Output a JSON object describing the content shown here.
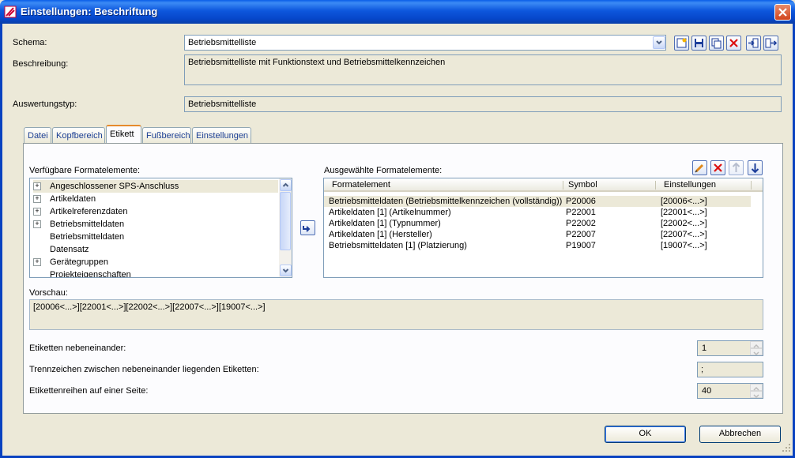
{
  "window": {
    "title": "Einstellungen: Beschriftung"
  },
  "schema": {
    "label": "Schema:",
    "value": "Betriebsmittelliste"
  },
  "beschreibung": {
    "label": "Beschreibung:",
    "value": "Betriebsmittelliste mit Funktionstext und Betriebsmittelkennzeichen"
  },
  "auswertungstyp": {
    "label": "Auswertungstyp:",
    "value": "Betriebsmittelliste"
  },
  "tabs": [
    {
      "label": "Datei"
    },
    {
      "label": "Kopfbereich"
    },
    {
      "label": "Etikett"
    },
    {
      "label": "Fußbereich"
    },
    {
      "label": "Einstellungen"
    }
  ],
  "available": {
    "label": "Verfügbare Formatelemente:",
    "items": [
      {
        "label": "Angeschlossener SPS-Anschluss",
        "expandable": true
      },
      {
        "label": "Artikeldaten",
        "expandable": true
      },
      {
        "label": "Artikelreferenzdaten",
        "expandable": true
      },
      {
        "label": "Betriebsmitteldaten",
        "expandable": true
      },
      {
        "label": "Betriebsmitteldaten",
        "expandable": false
      },
      {
        "label": "Datensatz",
        "expandable": false
      },
      {
        "label": "Gerätegruppen",
        "expandable": true
      },
      {
        "label": "Projekteigenschaften",
        "expandable": false
      }
    ]
  },
  "selected": {
    "label": "Ausgewählte Formatelemente:",
    "columns": [
      "Formatelement",
      "Symbol",
      "Einstellungen"
    ],
    "rows": [
      [
        "Betriebsmitteldaten (Betriebsmittelkennzeichen (vollständig))",
        "P20006",
        "[20006<...>]"
      ],
      [
        "Artikeldaten [1] (Artikelnummer)",
        "P22001",
        "[22001<...>]"
      ],
      [
        "Artikeldaten [1] (Typnummer)",
        "P22002",
        "[22002<...>]"
      ],
      [
        "Artikeldaten [1] (Hersteller)",
        "P22007",
        "[22007<...>]"
      ],
      [
        "Betriebsmitteldaten [1] (Platzierung)",
        "P19007",
        "[19007<...>]"
      ]
    ]
  },
  "vorschau": {
    "label": "Vorschau:",
    "value": "[20006<...>][22001<...>][22002<...>][22007<...>][19007<...>]"
  },
  "nebeneinander": {
    "label": "Etiketten nebeneinander:",
    "value": "1"
  },
  "trennzeichen": {
    "label": "Trennzeichen zwischen nebeneinander liegenden Etiketten:",
    "value": ";"
  },
  "reihen": {
    "label": "Etikettenreihen auf einer Seite:",
    "value": "40"
  },
  "buttons": {
    "ok": "OK",
    "cancel": "Abbrechen"
  },
  "colors": {
    "title_bar": "#0a5ee8",
    "dialog_bg": "#ece9d8",
    "tab_active_accent": "#e68b2c"
  }
}
